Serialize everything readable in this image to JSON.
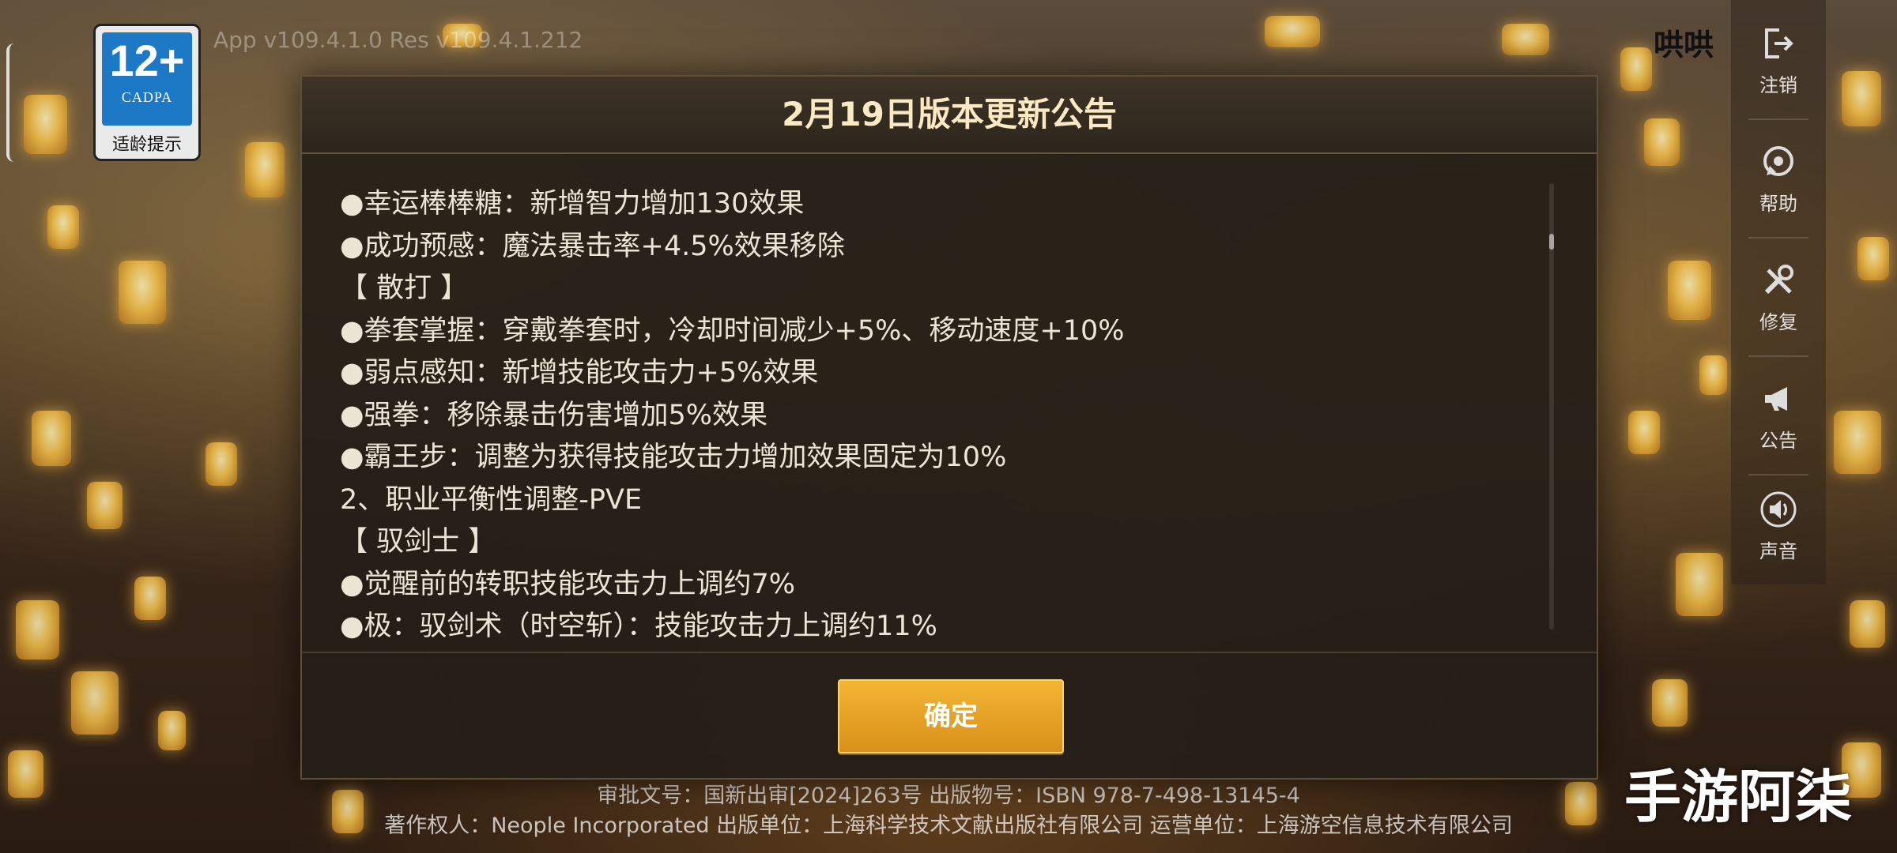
{
  "app": {
    "version_text": "App v109.4.1.0 Res v109.4.1.212",
    "username": "哄哄"
  },
  "age_badge": {
    "rating": "12+",
    "org": "CADPA",
    "caption": "适龄提示"
  },
  "sidebar": {
    "items": [
      {
        "label": "注销",
        "icon": "logout-icon"
      },
      {
        "label": "帮助",
        "icon": "help-icon"
      },
      {
        "label": "修复",
        "icon": "repair-tools-icon"
      },
      {
        "label": "公告",
        "icon": "megaphone-icon"
      },
      {
        "label": "声音",
        "icon": "speaker-icon"
      }
    ]
  },
  "dialog": {
    "title": "2月19日版本更新公告",
    "lines": [
      "●幸运棒棒糖：新增智力增加130效果",
      "●成功预感：魔法暴击率+4.5%效果移除",
      "【 散打 】",
      "●拳套掌握：穿戴拳套时，冷却时间减少+5%、移动速度+10%",
      "●弱点感知：新增技能攻击力+5%效果",
      "●强拳：移除暴击伤害增加5%效果",
      "●霸王步：调整为获得技能攻击力增加效果固定为10%",
      "2、职业平衡性调整-PVE",
      "【 驭剑士 】",
      "●觉醒前的转职技能攻击力上调约7%",
      "●极：驭剑术（时空斩）：技能攻击力上调约11%"
    ],
    "confirm_label": "确定"
  },
  "footer": {
    "approval": "审批文号：国新出审[2024]263号 出版物号：ISBN 978-7-498-13145-4",
    "copyright": "著作权人：Neople Incorporated 出版单位：上海科学技术文献出版社有限公司 运营单位：上海游空信息技术有限公司"
  },
  "watermark": "手游阿柒",
  "colors": {
    "accent": "#e1a024",
    "title": "#fbe9c3",
    "badge_blue": "#1d79c6"
  }
}
